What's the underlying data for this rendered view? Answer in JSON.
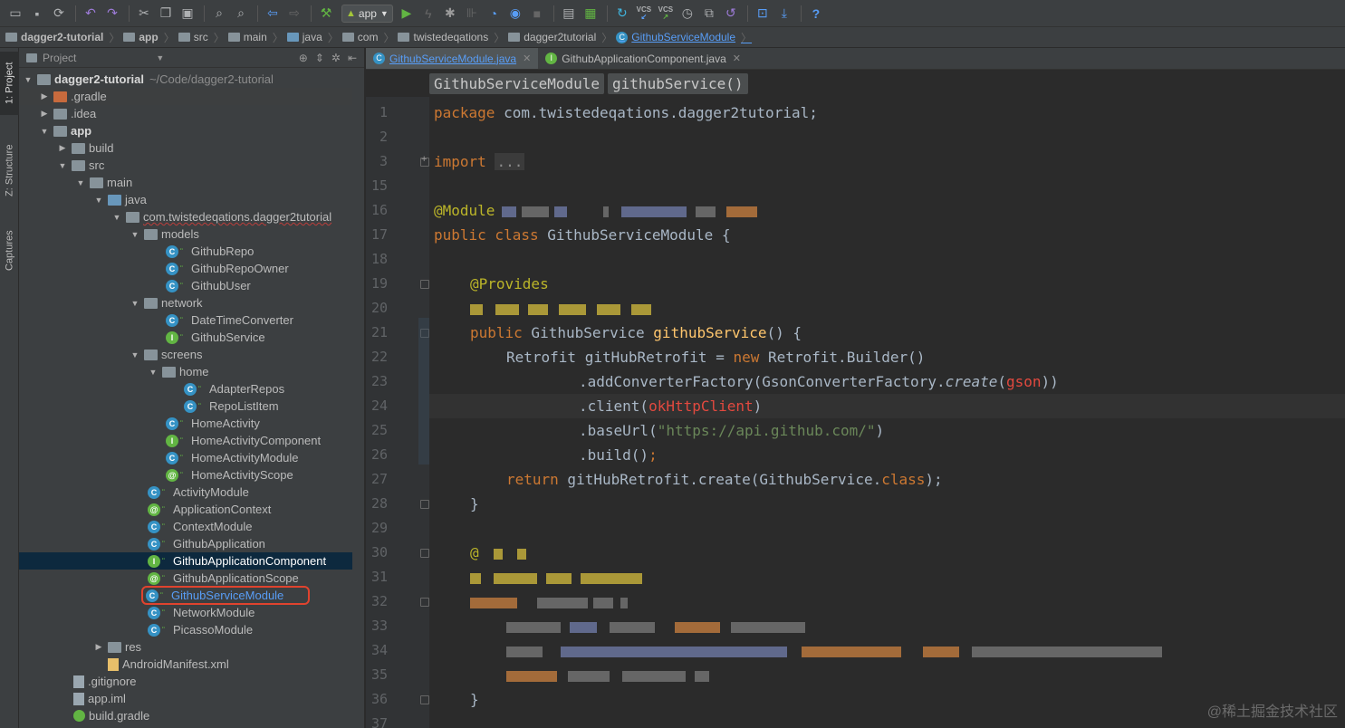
{
  "toolbar": {
    "run_config": "app",
    "icons": [
      "open-icon",
      "save-icon",
      "sync-icon",
      "undo-icon",
      "redo-icon",
      "cut-icon",
      "copy-icon",
      "paste-icon",
      "find-icon",
      "replace-icon",
      "back-icon",
      "forward-icon",
      "build-icon",
      "run-icon",
      "debug-icon",
      "profile-icon",
      "attach-icon",
      "coverage-icon",
      "stop-icon",
      "sdk-icon",
      "vcs-update-icon",
      "vcs-commit-icon",
      "history-icon",
      "revert-icon",
      "help-icon"
    ],
    "vcs1": "VCS",
    "vcs2": "VCS"
  },
  "breadcrumbs": [
    "dagger2-tutorial",
    "app",
    "src",
    "main",
    "java",
    "com",
    "twistedeqations",
    "dagger2tutorial",
    "GithubServiceModule"
  ],
  "left_strip": {
    "project": "1: Project",
    "structure": "Z: Structure",
    "captures": "Captures"
  },
  "project_panel": {
    "title": "Project",
    "tree": [
      {
        "label": "dagger2-tutorial",
        "suffix": "~/Code/dagger2-tutorial"
      },
      {
        "label": ".gradle"
      },
      {
        "label": ".idea"
      },
      {
        "label": "app"
      },
      {
        "label": "build"
      },
      {
        "label": "src"
      },
      {
        "label": "main"
      },
      {
        "label": "java"
      },
      {
        "label": "com.twistedeqations.dagger2tutorial"
      },
      {
        "label": "models"
      },
      {
        "label": "GithubRepo"
      },
      {
        "label": "GithubRepoOwner"
      },
      {
        "label": "GithubUser"
      },
      {
        "label": "network"
      },
      {
        "label": "DateTimeConverter"
      },
      {
        "label": "GithubService"
      },
      {
        "label": "screens"
      },
      {
        "label": "home"
      },
      {
        "label": "AdapterRepos"
      },
      {
        "label": "RepoListItem"
      },
      {
        "label": "HomeActivity"
      },
      {
        "label": "HomeActivityComponent"
      },
      {
        "label": "HomeActivityModule"
      },
      {
        "label": "HomeActivityScope"
      },
      {
        "label": "ActivityModule"
      },
      {
        "label": "ApplicationContext"
      },
      {
        "label": "ContextModule"
      },
      {
        "label": "GithubApplication"
      },
      {
        "label": "GithubApplicationComponent"
      },
      {
        "label": "GithubApplicationScope"
      },
      {
        "label": "GithubServiceModule"
      },
      {
        "label": "NetworkModule"
      },
      {
        "label": "PicassoModule"
      },
      {
        "label": "res"
      },
      {
        "label": "AndroidManifest.xml"
      },
      {
        "label": ".gitignore"
      },
      {
        "label": "app.iml"
      },
      {
        "label": "build.gradle"
      }
    ]
  },
  "editor": {
    "tabs": [
      {
        "label": "GithubServiceModule.java",
        "active": true
      },
      {
        "label": "GithubApplicationComponent.java",
        "active": false
      }
    ],
    "crumbs": [
      "GithubServiceModule",
      "githubService()"
    ],
    "line_numbers": [
      "1",
      "2",
      "3",
      "15",
      "16",
      "17",
      "18",
      "19",
      "20",
      "21",
      "22",
      "23",
      "24",
      "25",
      "26",
      "27",
      "28",
      "29",
      "30",
      "31",
      "32",
      "33",
      "34",
      "35",
      "36",
      "37"
    ],
    "code": {
      "l1_kw": "package",
      "l1_rest": " com.twistedeqations.dagger2tutorial;",
      "l3_kw": "import",
      "l3_fold": "...",
      "l16_ann": "@Module",
      "l17_kw": "public class",
      "l17_rest": " GithubServiceModule {",
      "l19_ann": "@Provides",
      "l21_kw": "public",
      "l21_type": " GithubService ",
      "l21_fn": "githubService",
      "l21_rest": "() {",
      "l22_a": "Retrofit gitHubRetrofit = ",
      "l22_kw": "new",
      "l22_b": " Retrofit.Builder()",
      "l23_a": ".addConverterFactory(GsonConverterFactory.",
      "l23_it": "create",
      "l23_b": "(",
      "l23_red": "gson",
      "l23_c": "))",
      "l24_a": ".client(",
      "l24_red": "okHttpClient",
      "l24_b": ")",
      "l25_a": ".baseUrl(",
      "l25_str": "\"https://api.github.com/\"",
      "l25_b": ")",
      "l26_a": ".build()",
      "l26_kw": ";",
      "l27_kw": "return",
      "l27_a": " gitHubRetrofit.create(GithubService.",
      "l27_kw2": "class",
      "l27_b": ");",
      "l28": "}",
      "l30_ann": "@",
      "l36": "}"
    }
  },
  "watermark": "@稀土掘金技术社区"
}
